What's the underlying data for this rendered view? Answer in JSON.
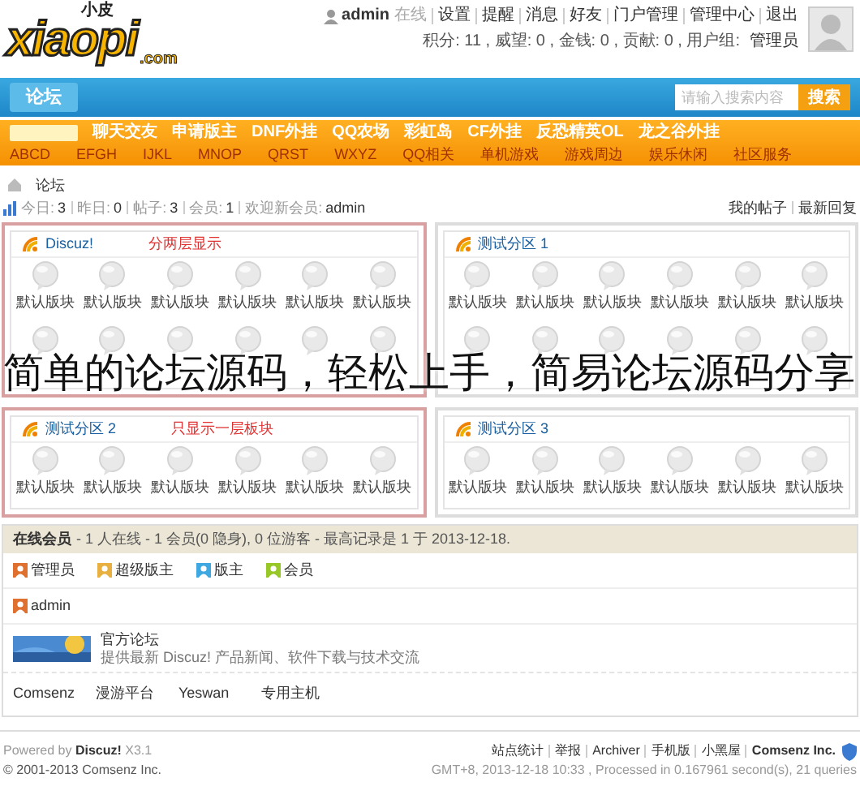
{
  "logo": {
    "main": "xiaopi",
    "small": "小皮",
    "domain": ".com"
  },
  "user_bar": {
    "username": "admin",
    "status": "在线",
    "links": [
      "设置",
      "提醒",
      "消息",
      "好友",
      "门户管理",
      "管理中心",
      "退出"
    ],
    "stats": "积分: 11 , 威望: 0 , 金钱: 0 , 贡献: 0 , 用户组:",
    "group": "管理员"
  },
  "nav": {
    "tabs": [
      {
        "label": "论坛",
        "selected": true
      }
    ],
    "search": {
      "placeholder": "请输入搜索内容",
      "button": "搜索"
    }
  },
  "sub_nav": {
    "primary": [
      "聊天交友",
      "申请版主",
      "DNF外挂",
      "QQ农场",
      "彩虹岛",
      "CF外挂",
      "反恐精英OL",
      "龙之谷外挂"
    ],
    "secondary": [
      "ABCD",
      "EFGH",
      "IJKL",
      "MNOP",
      "QRST",
      "WXYZ",
      "QQ相关",
      "单机游戏",
      "游戏周边",
      "娱乐休闲",
      "社区服务"
    ]
  },
  "breadcrumb": "论坛",
  "stats": {
    "items": [
      {
        "label": "今日:",
        "value": "3"
      },
      {
        "label": "昨日:",
        "value": "0"
      },
      {
        "label": "帖子:",
        "value": "3"
      },
      {
        "label": "会员:",
        "value": "1"
      },
      {
        "label": "欢迎新会员:",
        "value": "admin"
      }
    ],
    "links": [
      "我的帖子",
      "最新回复"
    ]
  },
  "categories": [
    {
      "title": "Discuz!",
      "note": "分两层显示",
      "highlighted": true,
      "rows": [
        {
          "forums": [
            {
              "label": "默认版块"
            },
            {
              "label": "默认版块"
            },
            {
              "label": "默认版块"
            },
            {
              "label": "默认版块"
            },
            {
              "label": "默认版块"
            },
            {
              "label": "默认版块"
            }
          ]
        },
        {
          "forums": [
            {
              "kind": "icon"
            },
            {
              "kind": "icon"
            },
            {
              "kind": "icon"
            },
            {
              "kind": "icon"
            },
            {
              "kind": "icon"
            },
            {
              "kind": "icon"
            }
          ]
        }
      ]
    },
    {
      "title": "测试分区 1",
      "highlighted": false,
      "rows": [
        {
          "forums": [
            {
              "label": "默认版块"
            },
            {
              "label": "默认版块"
            },
            {
              "label": "默认版块"
            },
            {
              "label": "默认版块"
            },
            {
              "label": "默认版块"
            },
            {
              "label": "默认版块"
            }
          ]
        },
        {
          "forums": [
            {
              "kind": "icon"
            },
            {
              "kind": "icon"
            },
            {
              "kind": "icon"
            },
            {
              "kind": "icon"
            },
            {
              "kind": "icon"
            },
            {
              "kind": "icon"
            }
          ]
        }
      ]
    },
    {
      "title": "测试分区 2",
      "note": "只显示一层板块",
      "highlighted": true,
      "rows": [
        {
          "forums": [
            {
              "label": "默认版块"
            },
            {
              "label": "默认版块"
            },
            {
              "label": "默认版块"
            },
            {
              "label": "默认版块"
            },
            {
              "label": "默认版块"
            },
            {
              "label": "默认版块"
            }
          ]
        }
      ]
    },
    {
      "title": "测试分区 3",
      "highlighted": false,
      "rows": [
        {
          "forums": [
            {
              "label": "默认版块"
            },
            {
              "label": "默认版块"
            },
            {
              "label": "默认版块"
            },
            {
              "label": "默认版块"
            },
            {
              "label": "默认版块"
            },
            {
              "label": "默认版块"
            }
          ]
        }
      ]
    }
  ],
  "caption": "简单的论坛源码，轻松上手，简易论坛源码分享",
  "online": {
    "title": "在线会员",
    "summary": "- 1 人在线 - 1 会员(0 隐身), 0 位游客 - 最高记录是 1 于 2013-12-18.",
    "legend": [
      {
        "label": "管理员",
        "color": "#e07030"
      },
      {
        "label": "超级版主",
        "color": "#e8b040"
      },
      {
        "label": "版主",
        "color": "#40a8e0"
      },
      {
        "label": "会员",
        "color": "#98c828"
      }
    ],
    "members": [
      {
        "name": "admin",
        "color": "#e07030"
      }
    ]
  },
  "partner": {
    "title": "官方论坛",
    "description": "提供最新 Discuz! 产品新闻、软件下载与技术交流"
  },
  "text_links": [
    "Comsenz",
    "漫游平台",
    "Yeswan",
    "专用主机"
  ],
  "footer": {
    "powered": "Powered by **Discuz!** X3.1",
    "copyright": "© 2001-2013 Comsenz Inc.",
    "links": [
      "站点统计",
      "举报",
      "Archiver",
      "手机版",
      "小黑屋",
      "Comsenz Inc."
    ],
    "timing": "GMT+8, 2013-12-18 10:33 , Processed in 0.167961 second(s), 21 queries"
  }
}
